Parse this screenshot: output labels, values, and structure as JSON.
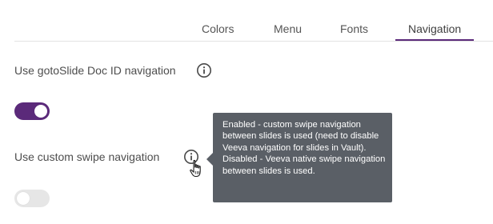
{
  "tabs": [
    {
      "label": "Colors",
      "active": false
    },
    {
      "label": "Menu",
      "active": false
    },
    {
      "label": "Fonts",
      "active": false
    },
    {
      "label": "Navigation",
      "active": true
    }
  ],
  "settings": [
    {
      "label": "Use gotoSlide Doc ID navigation",
      "enabled": true,
      "info_icon": "info-icon"
    },
    {
      "label": "Use custom swipe navigation",
      "enabled": false,
      "info_icon": "info-icon"
    }
  ],
  "tooltip": {
    "text": "Enabled - custom swipe navigation between slides is used (need to disable Veeva navigation for slides in Vault). Disabled - Veeva native swipe navigation between slides is used."
  },
  "cursor": "hand-pointer-icon",
  "colors": {
    "accent": "#5b2a7a",
    "toggle_off": "#e6e6e6",
    "tooltip_bg": "#5a5f66",
    "text": "#4d4d4d"
  }
}
